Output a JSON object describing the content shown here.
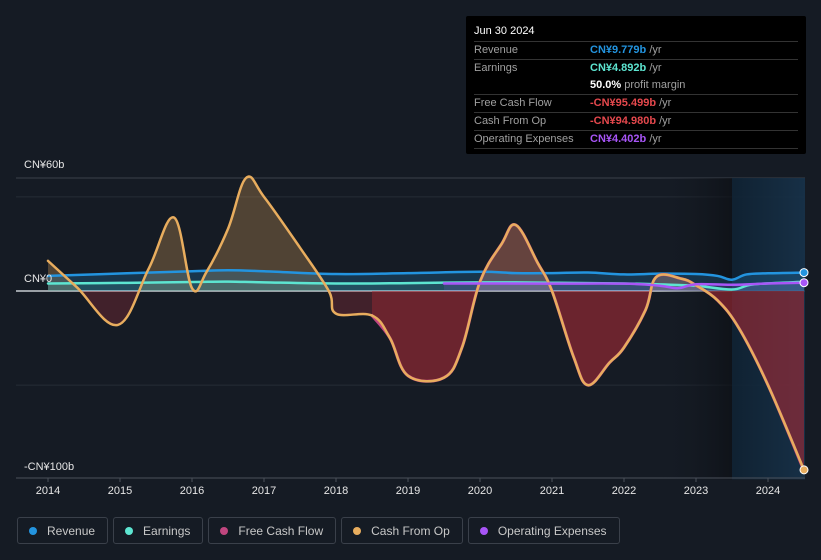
{
  "tooltip": {
    "date": "Jun 30 2024",
    "rows": [
      {
        "label": "Revenue",
        "value": "CN¥9.779b",
        "unit": " /yr",
        "color": "#2394df"
      },
      {
        "label": "Earnings",
        "value": "CN¥4.892b",
        "unit": " /yr",
        "color": "#5de5d1"
      },
      {
        "label": "",
        "value": "50.0%",
        "unit": " profit margin",
        "color": "#ffffff"
      },
      {
        "label": "Free Cash Flow",
        "value": "-CN¥95.499b",
        "unit": " /yr",
        "color": "#e5484d"
      },
      {
        "label": "Cash From Op",
        "value": "-CN¥94.980b",
        "unit": " /yr",
        "color": "#e5484d"
      },
      {
        "label": "Operating Expenses",
        "value": "CN¥4.402b",
        "unit": " /yr",
        "color": "#a855f7"
      }
    ]
  },
  "legend": [
    {
      "label": "Revenue",
      "color": "#2394df"
    },
    {
      "label": "Earnings",
      "color": "#5de5d1"
    },
    {
      "label": "Free Cash Flow",
      "color": "#c0467f"
    },
    {
      "label": "Cash From Op",
      "color": "#e8ad5e"
    },
    {
      "label": "Operating Expenses",
      "color": "#a855f7"
    }
  ],
  "chart_data": {
    "type": "area",
    "title": "",
    "xlabel": "",
    "ylabel": "",
    "unit": "CN¥ billions",
    "ylim": [
      -100,
      60
    ],
    "xlim": [
      2014.0,
      2024.5
    ],
    "y_tick_labels": [
      {
        "value": 60,
        "label": "CN¥60b"
      },
      {
        "value": 0,
        "label": "CN¥0"
      },
      {
        "value": -100,
        "label": "-CN¥100b"
      }
    ],
    "x_tick_labels": [
      "2014",
      "2015",
      "2016",
      "2017",
      "2018",
      "2019",
      "2020",
      "2021",
      "2022",
      "2023",
      "2024"
    ],
    "highlight_range": [
      2023.5,
      2024.5
    ],
    "grid": true,
    "legend_position": "bottom",
    "series": [
      {
        "name": "Revenue",
        "color": "#2394df",
        "points": [
          [
            2014.0,
            8.0
          ],
          [
            2015.0,
            9.3
          ],
          [
            2016.0,
            10.5
          ],
          [
            2016.5,
            11.0
          ],
          [
            2017.0,
            10.5
          ],
          [
            2018.0,
            9.0
          ],
          [
            2019.0,
            9.5
          ],
          [
            2020.0,
            10.2
          ],
          [
            2020.5,
            9.5
          ],
          [
            2021.0,
            9.5
          ],
          [
            2021.5,
            9.8
          ],
          [
            2022.0,
            8.8
          ],
          [
            2022.5,
            9.2
          ],
          [
            2023.0,
            9.0
          ],
          [
            2023.3,
            8.0
          ],
          [
            2023.5,
            6.0
          ],
          [
            2023.7,
            8.8
          ],
          [
            2024.0,
            9.4
          ],
          [
            2024.5,
            9.779
          ]
        ]
      },
      {
        "name": "Earnings",
        "color": "#5de5d1",
        "points": [
          [
            2014.0,
            4.0
          ],
          [
            2015.0,
            4.3
          ],
          [
            2016.0,
            4.8
          ],
          [
            2016.5,
            5.0
          ],
          [
            2017.0,
            4.6
          ],
          [
            2018.0,
            4.0
          ],
          [
            2019.0,
            4.2
          ],
          [
            2020.0,
            4.6
          ],
          [
            2021.0,
            4.4
          ],
          [
            2022.0,
            4.0
          ],
          [
            2022.5,
            3.5
          ],
          [
            2023.0,
            2.8
          ],
          [
            2023.5,
            0.8
          ],
          [
            2023.8,
            3.5
          ],
          [
            2024.5,
            4.892
          ]
        ]
      },
      {
        "name": "Free Cash Flow",
        "color": "#c0467f",
        "points": [
          [
            2018.5,
            -13.0
          ],
          [
            2018.75,
            -25
          ],
          [
            2019.0,
            -45.0
          ],
          [
            2019.5,
            -46.0
          ],
          [
            2019.75,
            -30
          ],
          [
            2020.0,
            5
          ],
          [
            2020.3,
            25
          ],
          [
            2020.5,
            35.0
          ],
          [
            2020.8,
            15
          ],
          [
            2021.0,
            0
          ],
          [
            2021.3,
            -35
          ],
          [
            2021.5,
            -50.0
          ],
          [
            2021.8,
            -38
          ],
          [
            2022.0,
            -30
          ],
          [
            2022.3,
            -10
          ],
          [
            2022.45,
            7.5
          ],
          [
            2022.8,
            6.5
          ],
          [
            2023.0,
            3.0
          ],
          [
            2023.3,
            -5
          ],
          [
            2023.6,
            -20
          ],
          [
            2024.0,
            -50
          ],
          [
            2024.5,
            -95.499
          ]
        ]
      },
      {
        "name": "Cash From Op",
        "color": "#e8ad5e",
        "points": [
          [
            2014.0,
            16.0
          ],
          [
            2014.4,
            2
          ],
          [
            2014.97,
            -18.0
          ],
          [
            2015.4,
            12
          ],
          [
            2015.75,
            39.0
          ],
          [
            2016.0,
            1.5
          ],
          [
            2016.2,
            10
          ],
          [
            2016.5,
            33
          ],
          [
            2016.75,
            60.0
          ],
          [
            2017.0,
            50
          ],
          [
            2017.5,
            23
          ],
          [
            2017.9,
            0
          ],
          [
            2018.0,
            -12.0
          ],
          [
            2018.5,
            -13.0
          ],
          [
            2018.75,
            -25
          ],
          [
            2019.0,
            -45.0
          ],
          [
            2019.5,
            -46.0
          ],
          [
            2019.75,
            -30
          ],
          [
            2020.0,
            5
          ],
          [
            2020.3,
            25
          ],
          [
            2020.5,
            35.0
          ],
          [
            2020.8,
            15
          ],
          [
            2021.0,
            0
          ],
          [
            2021.3,
            -35
          ],
          [
            2021.5,
            -50.0
          ],
          [
            2021.8,
            -38
          ],
          [
            2022.0,
            -30
          ],
          [
            2022.3,
            -10
          ],
          [
            2022.45,
            7.5
          ],
          [
            2022.8,
            6.5
          ],
          [
            2023.0,
            3.0
          ],
          [
            2023.3,
            -5
          ],
          [
            2023.6,
            -20
          ],
          [
            2024.0,
            -50
          ],
          [
            2024.5,
            -94.98
          ]
        ]
      },
      {
        "name": "Operating Expenses",
        "color": "#a855f7",
        "points": [
          [
            2019.5,
            4.0
          ],
          [
            2020.0,
            4.0
          ],
          [
            2021.0,
            3.9
          ],
          [
            2022.0,
            3.9
          ],
          [
            2022.5,
            2.8
          ],
          [
            2022.75,
            1.5
          ],
          [
            2023.0,
            3.6
          ],
          [
            2023.5,
            3.3
          ],
          [
            2024.0,
            4.0
          ],
          [
            2024.5,
            4.402
          ]
        ]
      }
    ]
  }
}
